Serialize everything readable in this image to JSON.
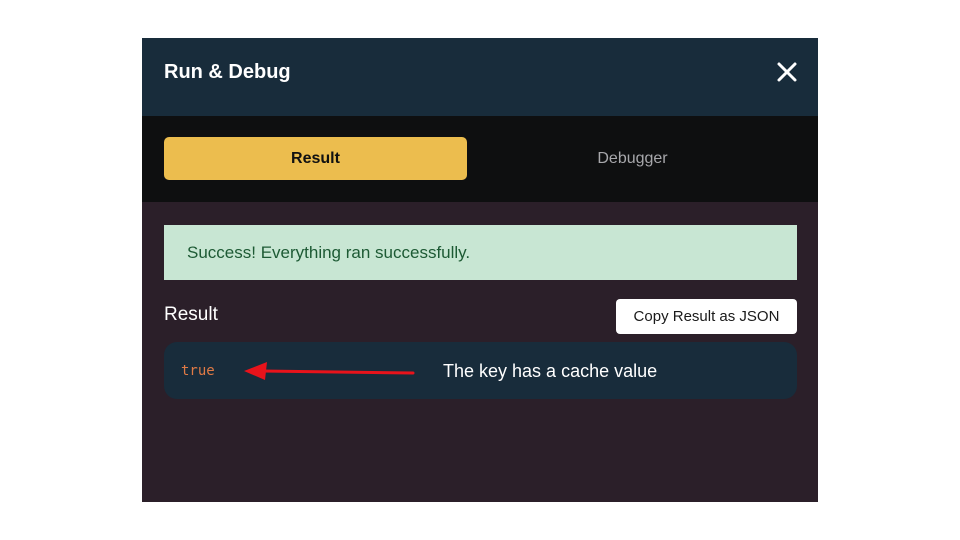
{
  "dialog": {
    "title": "Run & Debug",
    "close_icon": "close-icon"
  },
  "tabs": [
    {
      "label": "Result",
      "active": true
    },
    {
      "label": "Debugger",
      "active": false
    }
  ],
  "alert": {
    "message": "Success! Everything ran successfully."
  },
  "result": {
    "heading": "Result",
    "copy_button_label": "Copy Result as JSON",
    "value": "true"
  },
  "annotation": {
    "text": "The key has a cache value",
    "arrow_icon": "arrow-left-icon"
  },
  "colors": {
    "header_bg": "#182c3b",
    "dialog_bg": "#2b1f29",
    "tabbar_bg": "#0e0f10",
    "active_tab_bg": "#ecbd4e",
    "success_bg": "#c8e6d3",
    "success_text": "#1d5a34",
    "result_value": "#e07a45",
    "annotation_arrow": "#e8131b"
  }
}
